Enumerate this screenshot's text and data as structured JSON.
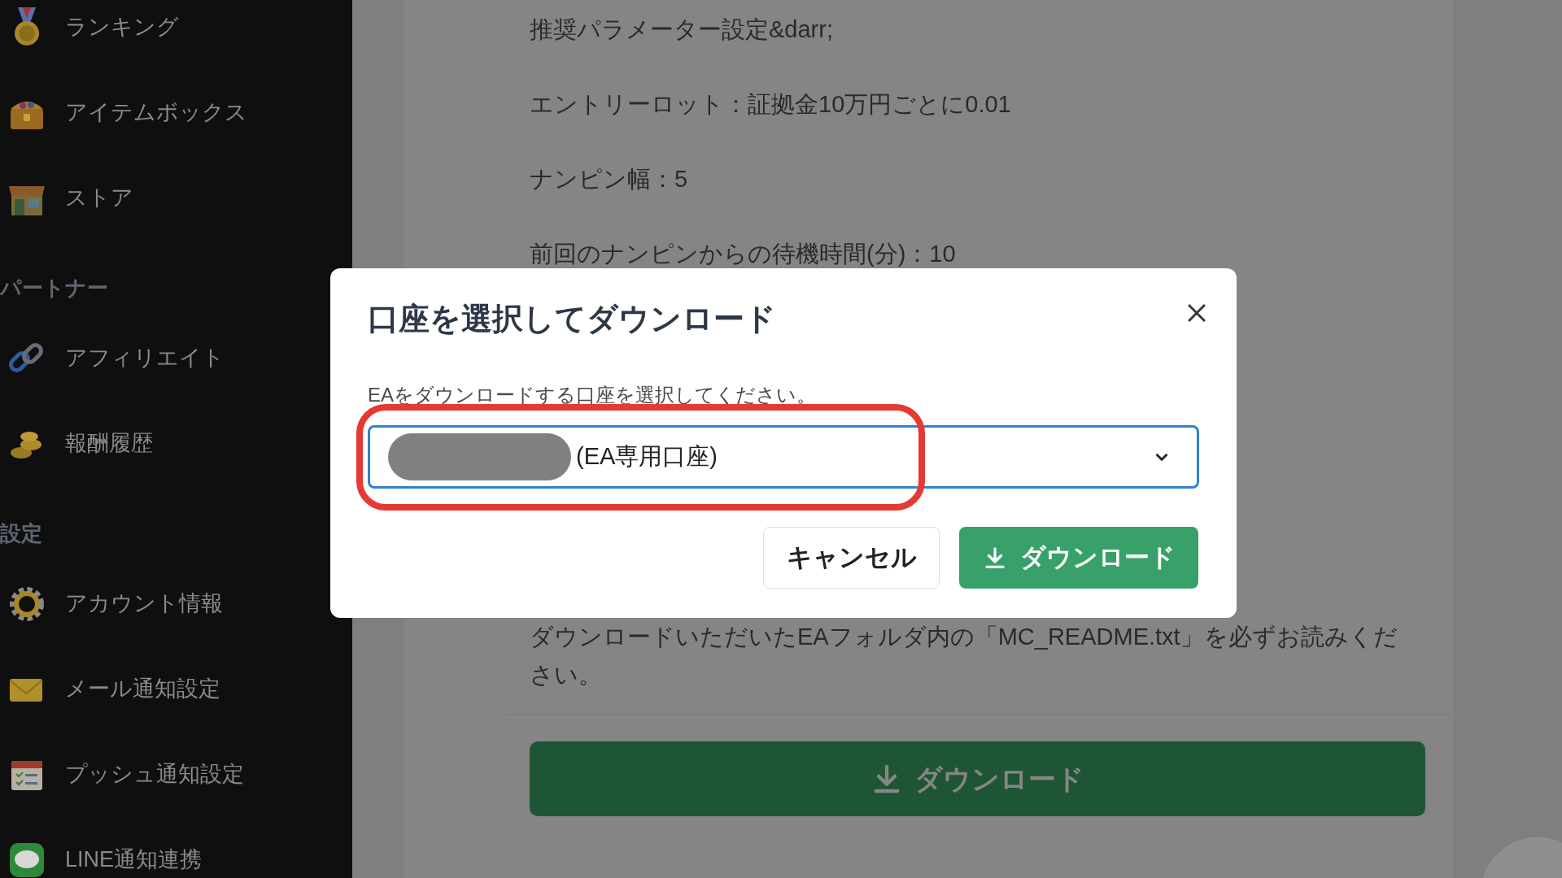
{
  "sidebar": {
    "sections": [
      {
        "items": [
          {
            "label": "ランキング"
          },
          {
            "label": "アイテムボックス"
          },
          {
            "label": "ストア"
          }
        ]
      },
      {
        "heading": "パートナー",
        "items": [
          {
            "label": "アフィリエイト"
          },
          {
            "label": "報酬履歴"
          }
        ]
      },
      {
        "heading": "設定",
        "items": [
          {
            "label": "アカウント情報"
          },
          {
            "label": "メール通知設定"
          },
          {
            "label": "プッシュ通知設定"
          },
          {
            "label": "LINE通知連携"
          }
        ]
      }
    ]
  },
  "content": {
    "lines_top": [
      "推奨パラメーター設定&darr;",
      "エントリーロット：証拠金10万円ごとに0.01",
      "ナンピン幅：5",
      "前回のナンピンからの待機時間(分)：10"
    ],
    "lines_bottom": "ダウンロードいただいたEAフォルダ内の「MC_README.txt」を必ずお読みください。",
    "download_button": "ダウンロード"
  },
  "dialog": {
    "title": "口座を選択してダウンロード",
    "description": "EAをダウンロードする口座を選択してください。",
    "select": {
      "value": "(EA専用口座)"
    },
    "cancel_button": "キャンセル",
    "download_button": "ダウンロード"
  }
}
